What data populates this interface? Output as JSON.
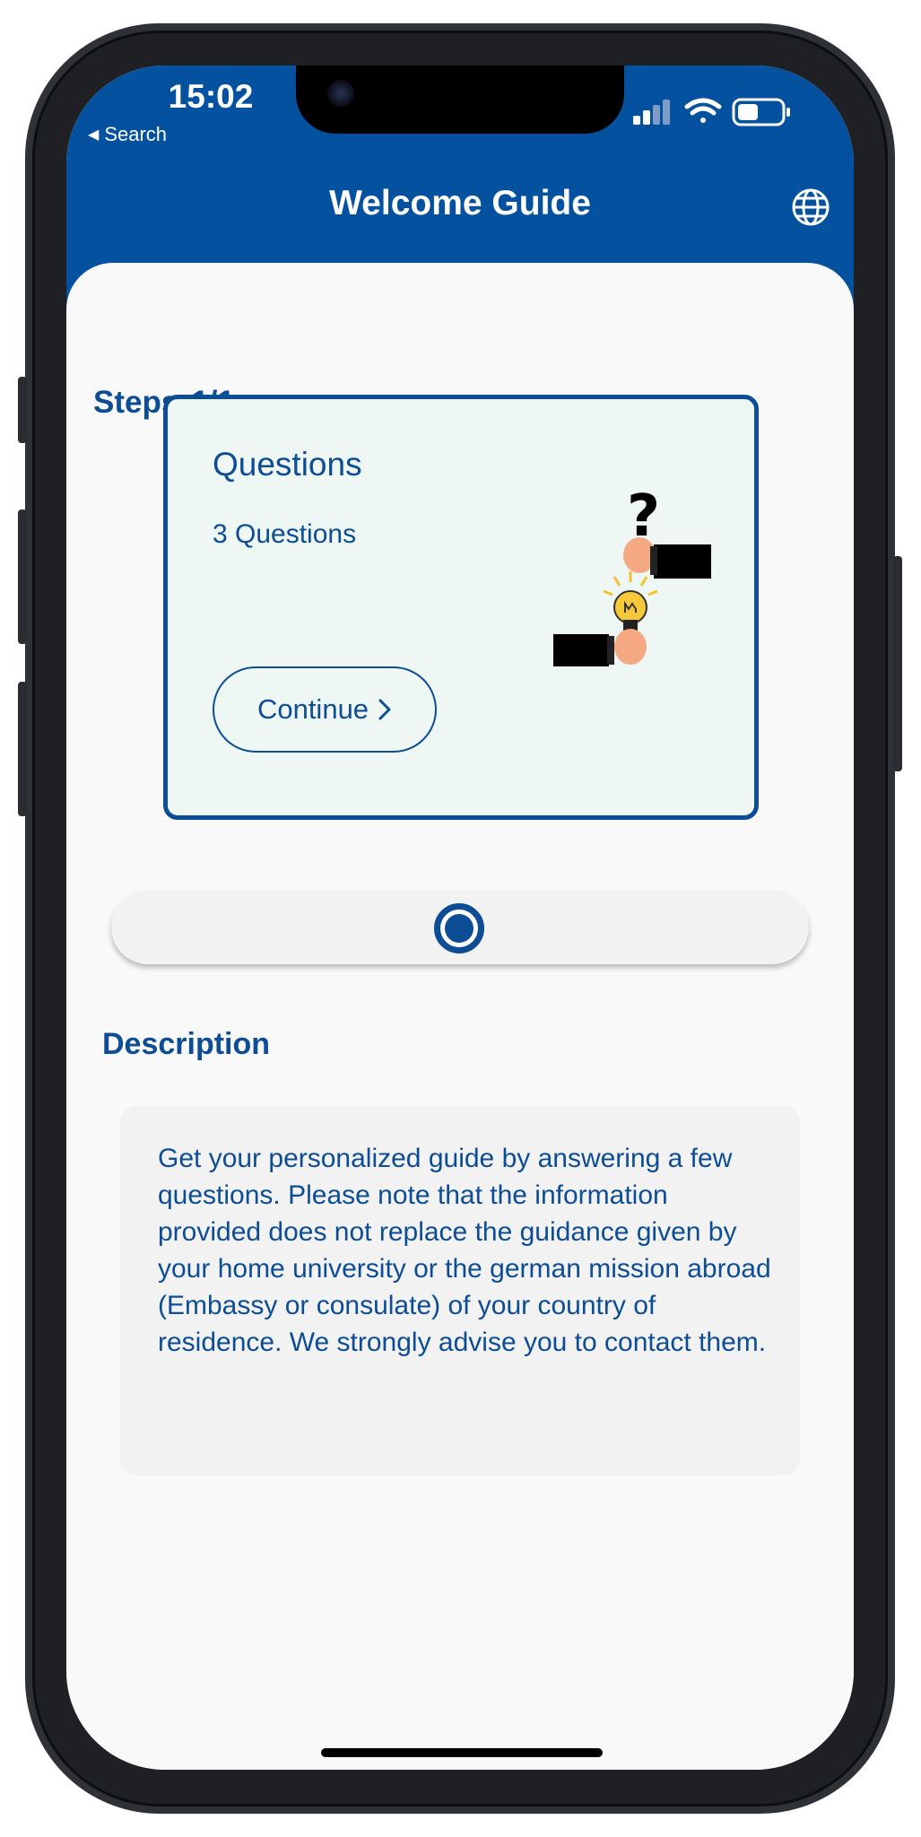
{
  "status_bar": {
    "time": "15:02",
    "back_label": "Search",
    "icons": [
      "cellular-signal-icon",
      "wifi-icon",
      "battery-icon"
    ]
  },
  "header": {
    "title": "Welcome Guide",
    "language_icon": "globe-icon",
    "background_color": "#04529f"
  },
  "steps": {
    "label": "Steps",
    "progress": "1/1"
  },
  "card": {
    "title": "Questions",
    "subtitle": "3 Questions",
    "button_label": "Continue",
    "button_icon": "chevron-right-icon",
    "illustration": "question-and-idea-hands-illustration"
  },
  "pager": {
    "current_page": 1,
    "total_pages": 1
  },
  "description": {
    "heading": "Description",
    "text": "Get your personalized guide by answering a few questions. Please note that the information provided does not replace the guidance given by your home university or the german mission abroad (Embassy or consulate) of your country of residence. We strongly advise you to contact them."
  },
  "colors": {
    "accent": "#0c4d96",
    "card_background": "#eef7f3",
    "page_background": "#f9f9f9"
  }
}
